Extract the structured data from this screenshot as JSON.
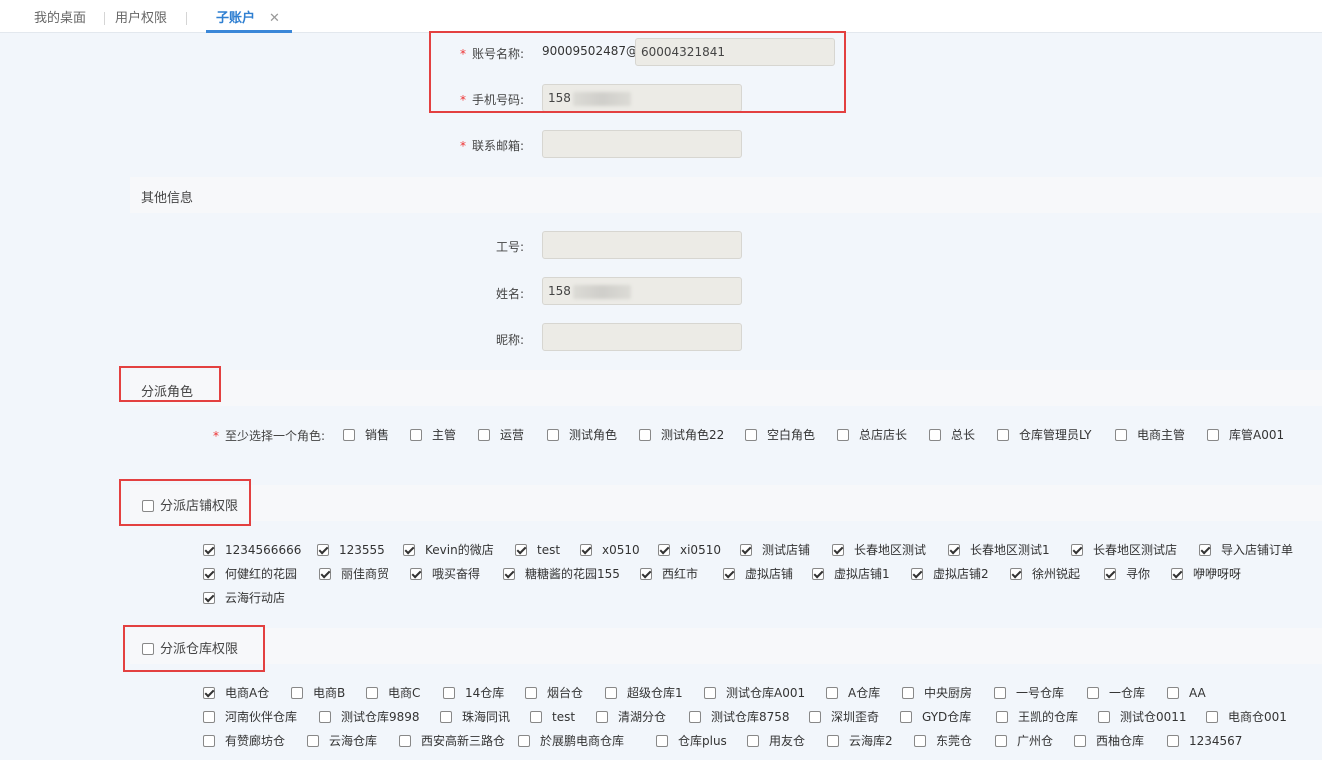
{
  "tabs": [
    {
      "label": "我的桌面",
      "active": false
    },
    {
      "label": "用户权限",
      "active": false
    },
    {
      "label": "子账户",
      "active": true
    }
  ],
  "tab_close_glyph": "✕",
  "account": {
    "name_label": "账号名称:",
    "name_prefix": "90009502487@",
    "name_value": "60004321841",
    "phone_label": "手机号码:",
    "phone_value": "158",
    "email_label": "联系邮箱:",
    "email_value": ""
  },
  "other_info": {
    "title": "其他信息",
    "job_no_label": "工号:",
    "job_no_value": "",
    "real_name_label": "姓名:",
    "real_name_value": "158",
    "nickname_label": "昵称:",
    "nickname_value": ""
  },
  "roles": {
    "title": "分派角色",
    "hint": "至少选择一个角色:",
    "items": [
      {
        "label": "销售",
        "checked": false
      },
      {
        "label": "主管",
        "checked": false
      },
      {
        "label": "运营",
        "checked": false
      },
      {
        "label": "测试角色",
        "checked": false
      },
      {
        "label": "测试角色22",
        "checked": false
      },
      {
        "label": "空白角色",
        "checked": false
      },
      {
        "label": "总店店长",
        "checked": false
      },
      {
        "label": "总长",
        "checked": false
      },
      {
        "label": "仓库管理员LY",
        "checked": false
      },
      {
        "label": "电商主管",
        "checked": false
      },
      {
        "label": "库管A001",
        "checked": false
      }
    ]
  },
  "shops": {
    "title": "分派店铺权限",
    "header_checked": false,
    "rows": [
      [
        {
          "label": "1234566666",
          "checked": true
        },
        {
          "label": "123555",
          "checked": true
        },
        {
          "label": "Kevin的微店",
          "checked": true
        },
        {
          "label": "test",
          "checked": true
        },
        {
          "label": "x0510",
          "checked": true
        },
        {
          "label": "xi0510",
          "checked": true
        },
        {
          "label": "测试店铺",
          "checked": true
        },
        {
          "label": "长春地区测试",
          "checked": true
        },
        {
          "label": "长春地区测试1",
          "checked": true
        },
        {
          "label": "长春地区测试店",
          "checked": true
        },
        {
          "label": "导入店铺订单",
          "checked": true
        }
      ],
      [
        {
          "label": "何健红的花园",
          "checked": true
        },
        {
          "label": "丽佳商贸",
          "checked": true
        },
        {
          "label": "哦买奋得",
          "checked": true
        },
        {
          "label": "糖糖酱的花园155",
          "checked": true
        },
        {
          "label": "西红市",
          "checked": true
        },
        {
          "label": "虚拟店铺",
          "checked": true
        },
        {
          "label": "虚拟店铺1",
          "checked": true
        },
        {
          "label": "虚拟店铺2",
          "checked": true
        },
        {
          "label": "徐州锐起",
          "checked": true
        },
        {
          "label": "寻你",
          "checked": true
        },
        {
          "label": "咿咿呀呀",
          "checked": true
        }
      ],
      [
        {
          "label": "云海行动店",
          "checked": true
        }
      ]
    ]
  },
  "warehouses": {
    "title": "分派仓库权限",
    "header_checked": false,
    "rows": [
      [
        {
          "label": "电商A仓",
          "checked": true
        },
        {
          "label": "电商B",
          "checked": false
        },
        {
          "label": "电商C",
          "checked": false
        },
        {
          "label": "14仓库",
          "checked": false
        },
        {
          "label": "烟台仓",
          "checked": false
        },
        {
          "label": "超级仓库1",
          "checked": false
        },
        {
          "label": "测试仓库A001",
          "checked": false
        },
        {
          "label": "A仓库",
          "checked": false
        },
        {
          "label": "中央厨房",
          "checked": false
        },
        {
          "label": "一号仓库",
          "checked": false
        },
        {
          "label": "一仓库",
          "checked": false
        },
        {
          "label": "AA",
          "checked": false
        }
      ],
      [
        {
          "label": "河南伙伴仓库",
          "checked": false
        },
        {
          "label": "测试仓库9898",
          "checked": false
        },
        {
          "label": "珠海同讯",
          "checked": false
        },
        {
          "label": "test",
          "checked": false
        },
        {
          "label": "清湖分仓",
          "checked": false
        },
        {
          "label": "测试仓库8758",
          "checked": false
        },
        {
          "label": "深圳歪奇",
          "checked": false
        },
        {
          "label": "GYD仓库",
          "checked": false
        },
        {
          "label": "王凯的仓库",
          "checked": false
        },
        {
          "label": "测试仓0011",
          "checked": false
        },
        {
          "label": "电商仓001",
          "checked": false
        }
      ],
      [
        {
          "label": "有赞廊坊仓",
          "checked": false
        },
        {
          "label": "云海仓库",
          "checked": false
        },
        {
          "label": "西安高新三路仓",
          "checked": false
        },
        {
          "label": "於展鹏电商仓库",
          "checked": false
        },
        {
          "label": "仓库plus",
          "checked": false
        },
        {
          "label": "用友仓",
          "checked": false
        },
        {
          "label": "云海库2",
          "checked": false
        },
        {
          "label": "东莞仓",
          "checked": false
        },
        {
          "label": "广州仓",
          "checked": false
        },
        {
          "label": "西柚仓库",
          "checked": false
        },
        {
          "label": "1234567",
          "checked": false
        }
      ]
    ]
  }
}
